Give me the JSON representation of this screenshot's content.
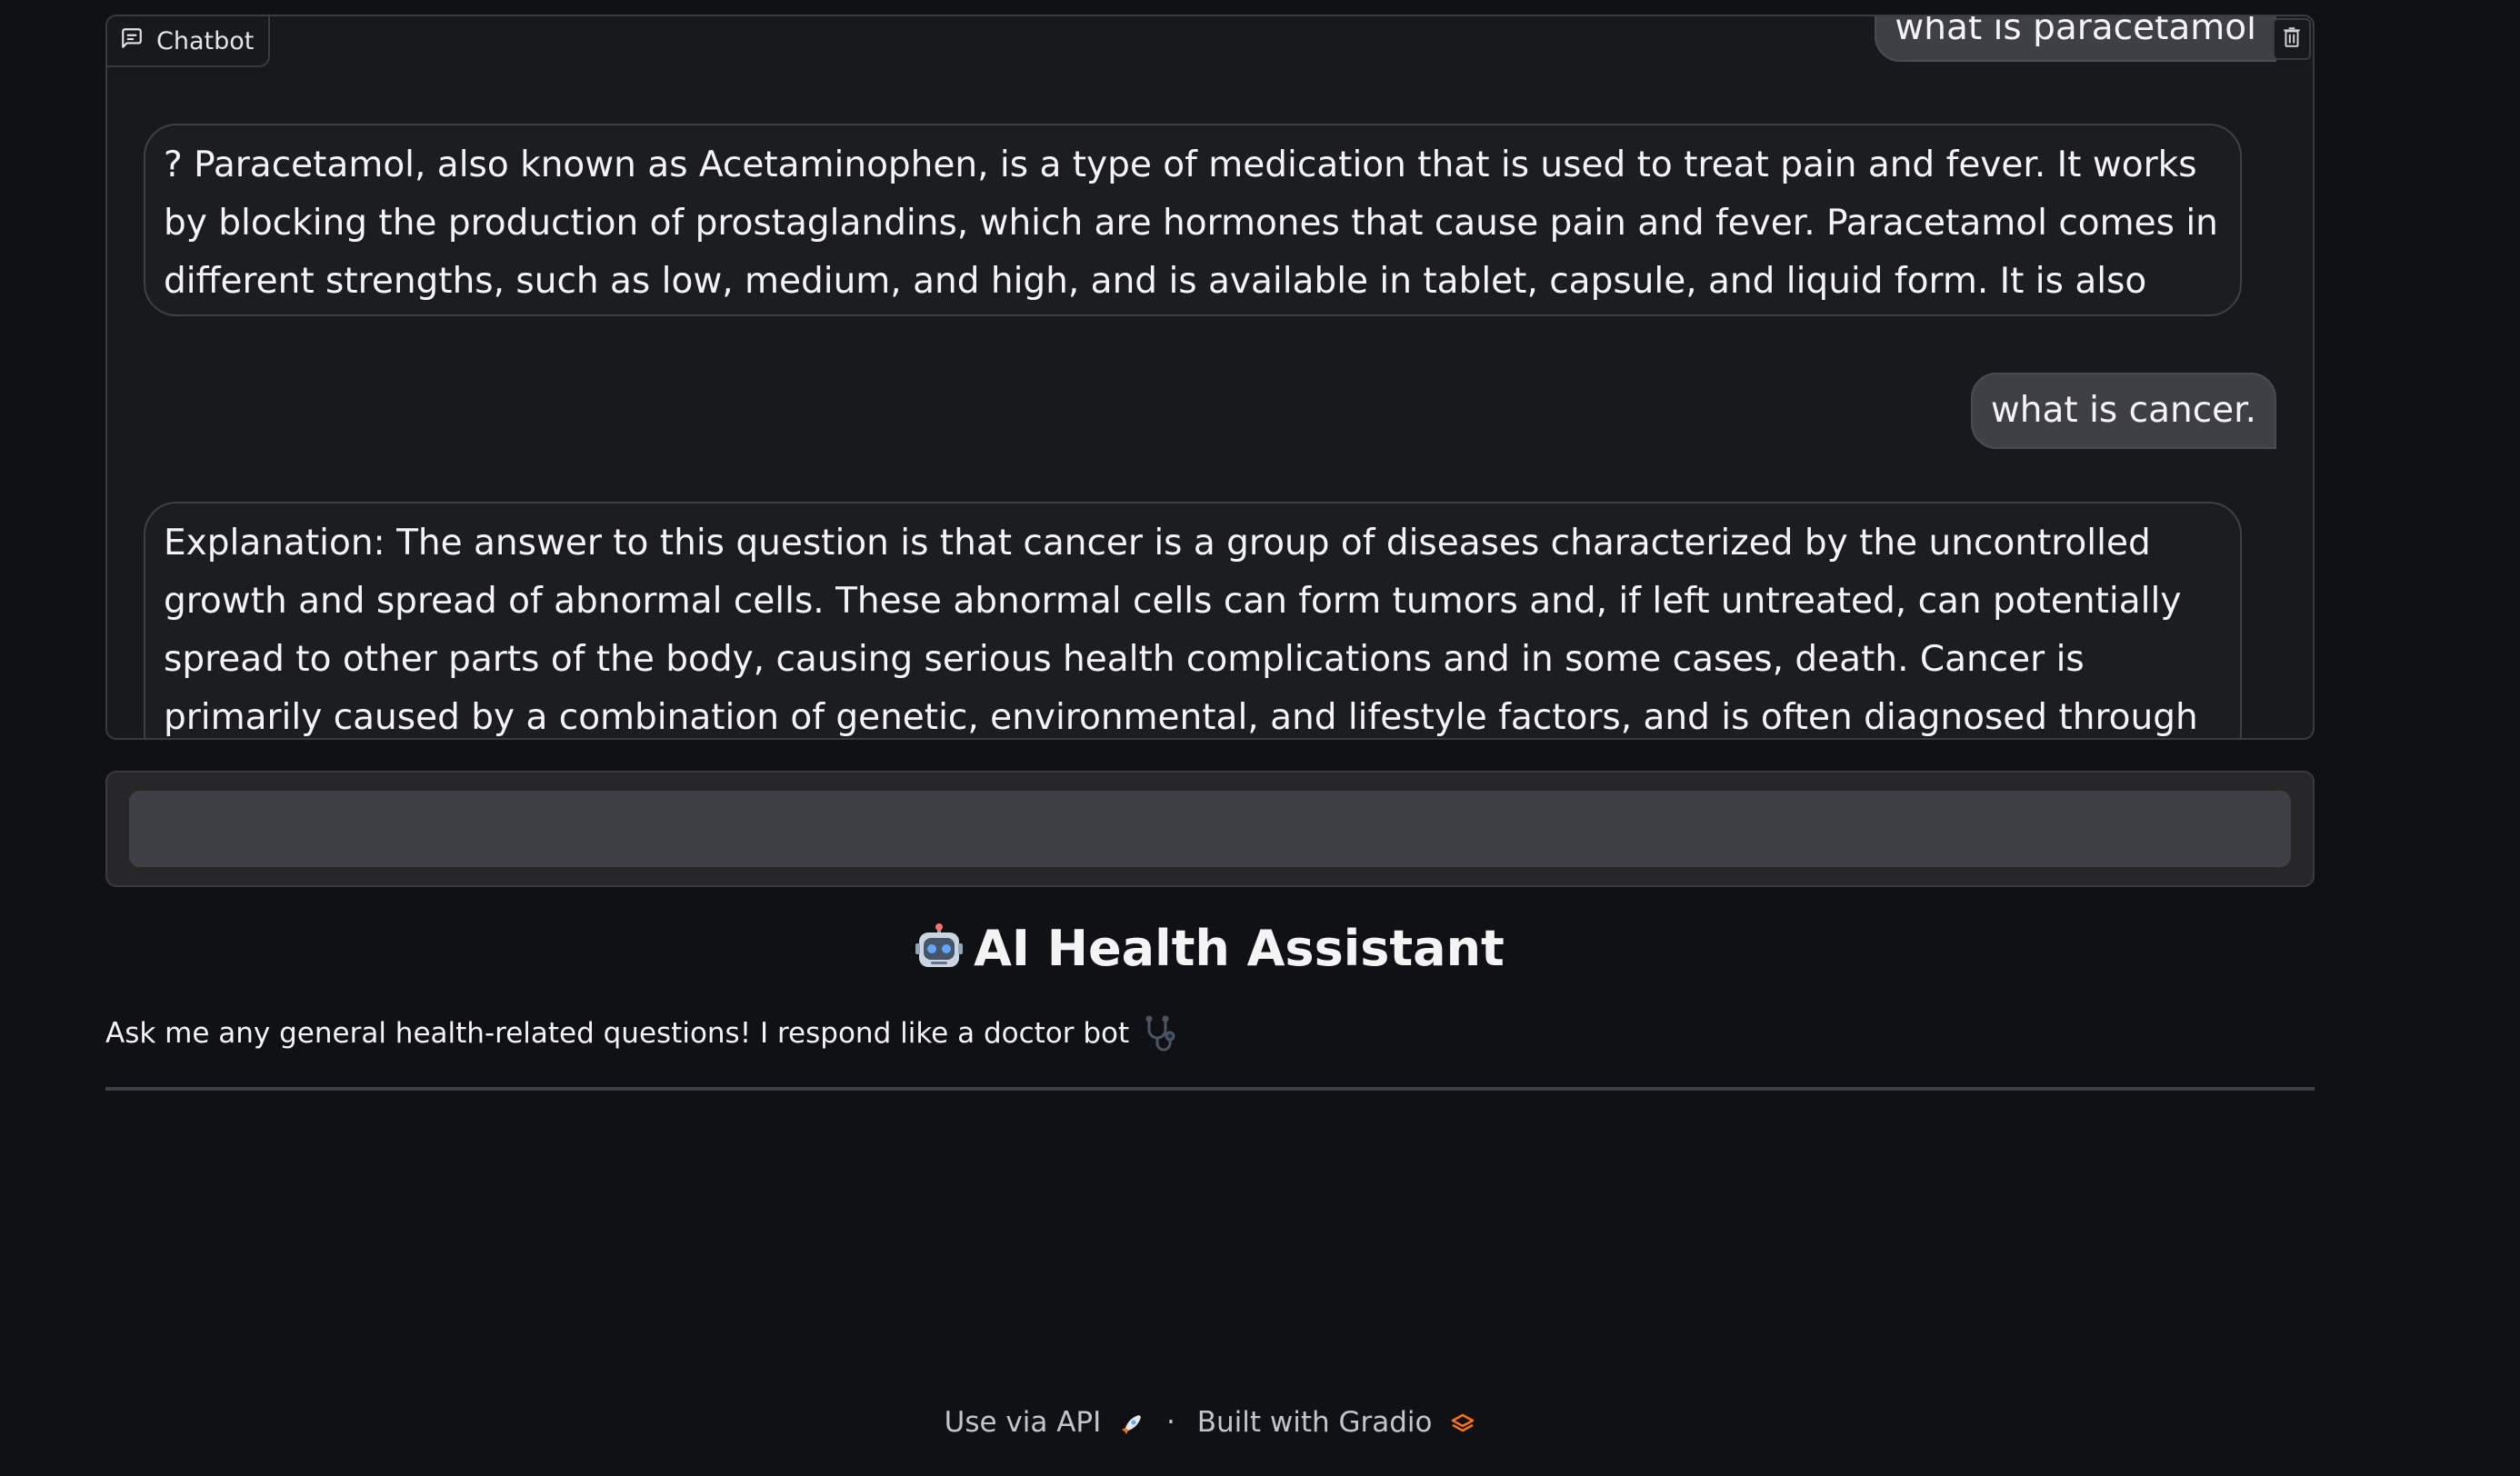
{
  "chatbot": {
    "label": "Chatbot",
    "icons": {
      "label": "chat-icon",
      "clear": "trash-icon"
    },
    "messages": [
      {
        "role": "user",
        "text": "what is paracetamol"
      },
      {
        "role": "bot",
        "text": "? Paracetamol, also known as Acetaminophen, is a type of medication that is used to treat pain and fever. It works by blocking the production of prostaglandins, which are hormones that cause pain and fever. Paracetamol comes in different strengths, such as low, medium, and high, and is available in tablet, capsule, and liquid form. It is also available over-the-"
      },
      {
        "role": "user",
        "text": "what is cancer."
      },
      {
        "role": "bot",
        "text": "Explanation: The answer to this question is that cancer is a group of diseases characterized by the uncontrolled growth and spread of abnormal cells. These abnormal cells can form tumors and, if left untreated, can potentially spread to other parts of the body, causing serious health complications and in some cases, death. Cancer is primarily caused by a combination of genetic, environmental, and lifestyle factors, and is often diagnosed through the detection of abnormal cells or"
      }
    ]
  },
  "input": {
    "value": "",
    "placeholder": ""
  },
  "header": {
    "title": "AI Health Assistant",
    "icon": "robot-face-icon"
  },
  "description": {
    "text": "Ask me any general health-related questions! I respond like a doctor bot",
    "icon": "stethoscope-icon"
  },
  "footer": {
    "api_label": "Use via API",
    "api_icon": "rocket-icon",
    "separator": "·",
    "built_label": "Built with Gradio",
    "built_icon": "gradio-logo-icon"
  },
  "colors": {
    "background": "#101114",
    "panel": "#18191c",
    "user_bubble": "#3f3f46",
    "input": "#3f3f46",
    "gradio_orange": "#f97316"
  }
}
